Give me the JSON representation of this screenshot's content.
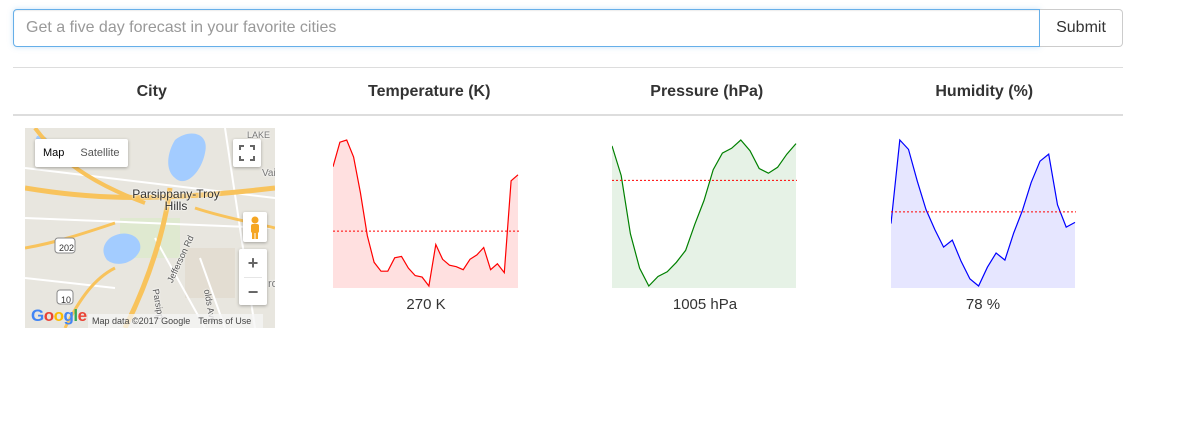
{
  "search": {
    "placeholder": "Get a five day forecast in your favorite cities",
    "value": "",
    "submit_label": "Submit"
  },
  "table": {
    "headers": [
      "City",
      "Temperature (K)",
      "Pressure (hPa)",
      "Humidity (%)"
    ]
  },
  "map": {
    "map_label": "Map",
    "satellite_label": "Satellite",
    "place_name": "Parsippany-Troy Hills",
    "place_name_line1": "Parsippany-Troy",
    "place_name_line2": "Hills",
    "lake_label": "LAKE",
    "road_label_1": "Jefferson Rd",
    "road_label_2": "Parsipp",
    "road_label_3": "olds Ave",
    "shield_202": "202",
    "shield_10": "10",
    "edge_label_1": "Vai",
    "edge_label_2": "ro",
    "google_logo": "Google",
    "credit": "Map data ©2017 Google",
    "terms": "Terms of Use",
    "zoom_in": "+",
    "zoom_out": "−",
    "colors": {
      "water": "#a3ccff",
      "land": "#e8e6df",
      "highway": "#f8c35c",
      "road": "#ffffff"
    }
  },
  "chart_data": [
    {
      "type": "area",
      "name": "temperature",
      "values": [
        12.95,
        14.6,
        14.75,
        13.6,
        11.2,
        8.3,
        6.5,
        5.9,
        5.9,
        6.8,
        6.9,
        6.1,
        5.6,
        5.5,
        4.9,
        7.7,
        6.7,
        6.3,
        6.2,
        6.0,
        6.7,
        7.0,
        7.5,
        6.0,
        6.4,
        5.8,
        12.0,
        12.4
      ],
      "mean_line": 8.6,
      "display_value": "270 K",
      "colors": {
        "line": "#ff0000",
        "fill": "#ffe0e0",
        "mean": "#ff0000"
      }
    },
    {
      "type": "area",
      "name": "pressure",
      "values": [
        16.4,
        13.9,
        9.0,
        6.1,
        4.6,
        5.4,
        5.8,
        6.6,
        7.6,
        9.8,
        11.8,
        14.4,
        15.8,
        16.2,
        16.9,
        16.0,
        14.5,
        14.1,
        14.6,
        15.7,
        16.6
      ],
      "mean_line": 13.5,
      "display_value": "1005 hPa",
      "colors": {
        "line": "#008000",
        "fill": "#e6f2e6",
        "mean": "#ff0000"
      }
    },
    {
      "type": "area",
      "name": "humidity",
      "values": [
        9.3,
        16.4,
        15.6,
        12.9,
        10.5,
        8.8,
        7.3,
        7.9,
        6.1,
        4.6,
        4.0,
        5.6,
        6.8,
        6.2,
        8.5,
        10.4,
        12.8,
        14.6,
        15.2,
        10.9,
        9.0,
        9.4
      ],
      "mean_line": 10.3,
      "display_value": "78 %",
      "colors": {
        "line": "#0000ff",
        "fill": "#e6e6ff",
        "mean": "#ff0000"
      }
    }
  ]
}
